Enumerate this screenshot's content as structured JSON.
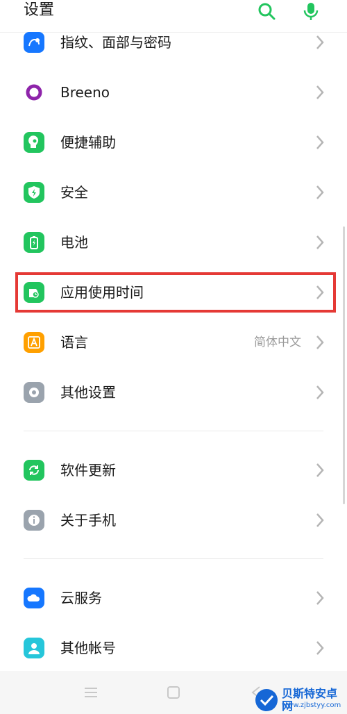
{
  "header": {
    "title": "设置"
  },
  "sections": [
    {
      "items": [
        {
          "label": "指纹、面部与密码",
          "icon": "fingerprint-face-icon",
          "color": "#1677ff"
        },
        {
          "label": "Breeno",
          "icon": "breeno-icon",
          "color": "#8e24aa"
        },
        {
          "label": "便捷辅助",
          "icon": "assist-icon",
          "color": "#22c55e"
        },
        {
          "label": "安全",
          "icon": "shield-icon",
          "color": "#22c55e"
        },
        {
          "label": "电池",
          "icon": "battery-icon",
          "color": "#22c55e"
        },
        {
          "label": "应用使用时间",
          "icon": "app-usage-time-icon",
          "color": "#22c55e"
        },
        {
          "label": "语言",
          "icon": "language-icon",
          "color": "#ffa000",
          "value": "简体中文"
        },
        {
          "label": "其他设置",
          "icon": "other-settings-icon",
          "color": "#9aa3ad"
        }
      ]
    },
    {
      "items": [
        {
          "label": "软件更新",
          "icon": "software-update-icon",
          "color": "#22c55e"
        },
        {
          "label": "关于手机",
          "icon": "about-phone-icon",
          "color": "#9aa3ad"
        }
      ]
    },
    {
      "items": [
        {
          "label": "云服务",
          "icon": "cloud-icon",
          "color": "#1677ff"
        },
        {
          "label": "其他帐号",
          "icon": "account-icon",
          "color": "#26c6da"
        }
      ]
    }
  ],
  "navbar": {
    "buttons": [
      "menu-icon",
      "home-icon",
      "back-icon"
    ]
  },
  "watermark": {
    "title": "贝斯特安卓网",
    "url": "www.zjbstyy.com"
  },
  "colors": {
    "accent": "#22c55e",
    "highlight": "#e53935",
    "watermark": "#1667d6"
  }
}
